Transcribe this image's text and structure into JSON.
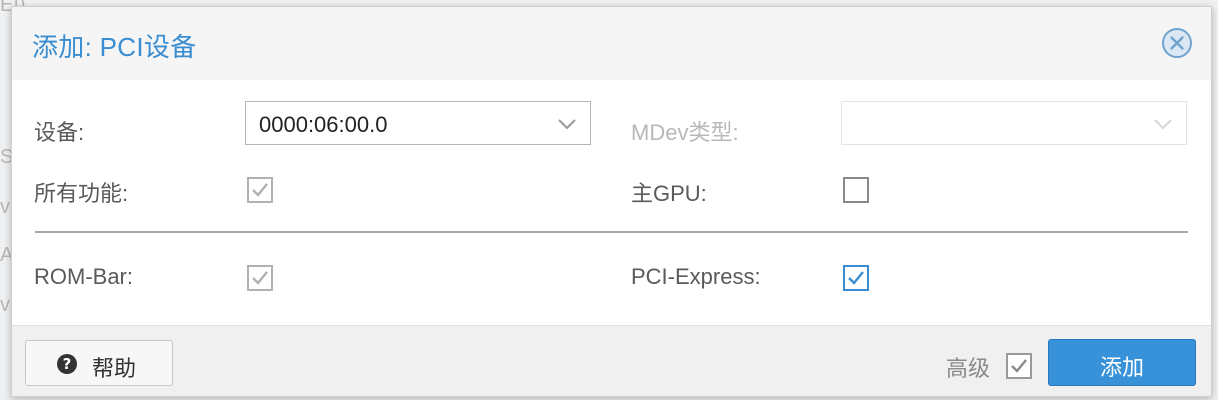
{
  "dialog": {
    "title": "添加: PCI设备",
    "close_icon": "close-circle-icon"
  },
  "form": {
    "device": {
      "label": "设备:",
      "value": "0000:06:00.0"
    },
    "mdev_type": {
      "label": "MDev类型:",
      "value": "",
      "disabled": true
    },
    "all_functions": {
      "label": "所有功能:",
      "checked": true,
      "disabled": true
    },
    "primary_gpu": {
      "label": "主GPU:",
      "checked": false
    },
    "rom_bar": {
      "label": "ROM-Bar:",
      "checked": true,
      "disabled": true
    },
    "pci_express": {
      "label": "PCI-Express:",
      "checked": true
    }
  },
  "footer": {
    "help_label": "帮助",
    "help_icon": "question-circle-icon",
    "advanced_label": "高级",
    "advanced_checked": true,
    "add_label": "添加"
  },
  "colors": {
    "accent": "#3892d9",
    "title": "#3a8dd0",
    "checkbox_active": "#3a8dd0",
    "checkbox_disabled": "#b0b0b0"
  }
}
